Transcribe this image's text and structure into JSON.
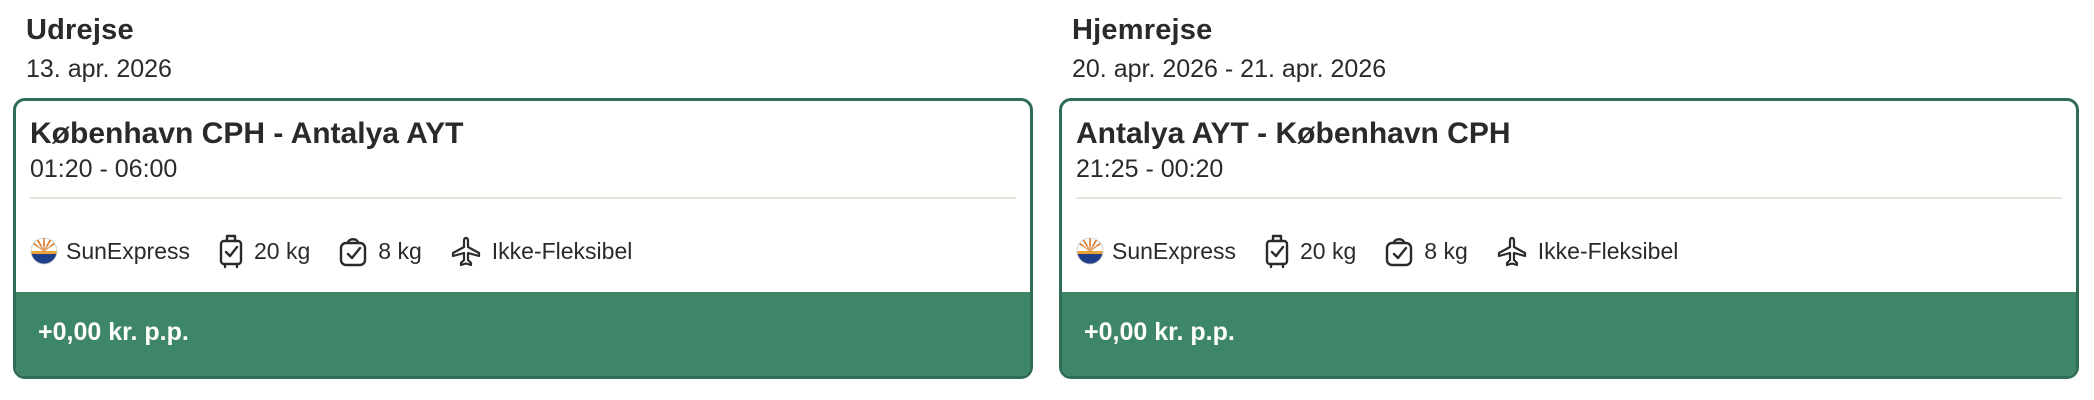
{
  "outbound": {
    "heading": "Udrejse",
    "date": "13. apr. 2026",
    "route": "København CPH - Antalya AYT",
    "times": "01:20 - 06:00",
    "airline": "SunExpress",
    "checked_bag": "20 kg",
    "carry_on": "8 kg",
    "flexibility": "Ikke-Fleksibel",
    "price": "+0,00 kr. p.p."
  },
  "return": {
    "heading": "Hjemrejse",
    "date": "20. apr. 2026 - 21. apr. 2026",
    "route": "Antalya AYT - København CPH",
    "times": "21:25 - 00:20",
    "airline": "SunExpress",
    "checked_bag": "20 kg",
    "carry_on": "8 kg",
    "flexibility": "Ikke-Fleksibel",
    "price": "+0,00 kr. p.p."
  },
  "colors": {
    "card_border": "#2f6e55",
    "price_bar": "#3d8667",
    "divider": "#e7e2da"
  },
  "icons": {
    "airline": "sunexpress-logo-icon",
    "checked_bag": "suitcase-check-icon",
    "carry_on": "bag-check-icon",
    "flexibility": "airplane-icon"
  }
}
